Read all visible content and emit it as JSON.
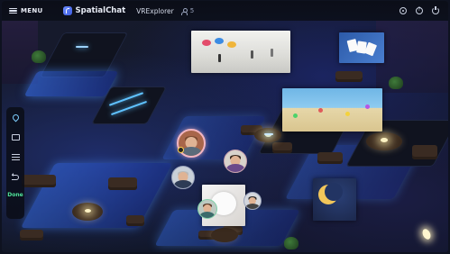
{
  "topbar": {
    "menu_label": "MENU",
    "brand": "SpatialChat",
    "space_name": "VRExplorer",
    "user_count": "5",
    "icons": [
      "settings-icon",
      "help-icon",
      "power-icon"
    ]
  },
  "toolbar": {
    "items": [
      {
        "icon": "location-pin-icon"
      },
      {
        "icon": "share-screen-icon"
      },
      {
        "icon": "settings-sliders-icon"
      },
      {
        "icon": "undo-icon"
      }
    ],
    "done_label": "Done"
  },
  "colors": {
    "background": "#121726",
    "floor_glow": "#3a78ff",
    "accent_green": "#4fe39a",
    "speaking_ring": "#f2b6c2",
    "topbar": "#0b0e18"
  },
  "media": [
    {
      "name": "gallery-screen"
    },
    {
      "name": "playing-cards-screen"
    },
    {
      "name": "beach-screen"
    },
    {
      "name": "moon-screen"
    },
    {
      "name": "pet-screen"
    }
  ],
  "avatars": [
    {
      "name": "avatar-1",
      "speaking": true
    },
    {
      "name": "avatar-2",
      "speaking": false
    },
    {
      "name": "avatar-3",
      "speaking": false
    },
    {
      "name": "avatar-4",
      "speaking": false
    },
    {
      "name": "avatar-5",
      "speaking": false
    }
  ]
}
